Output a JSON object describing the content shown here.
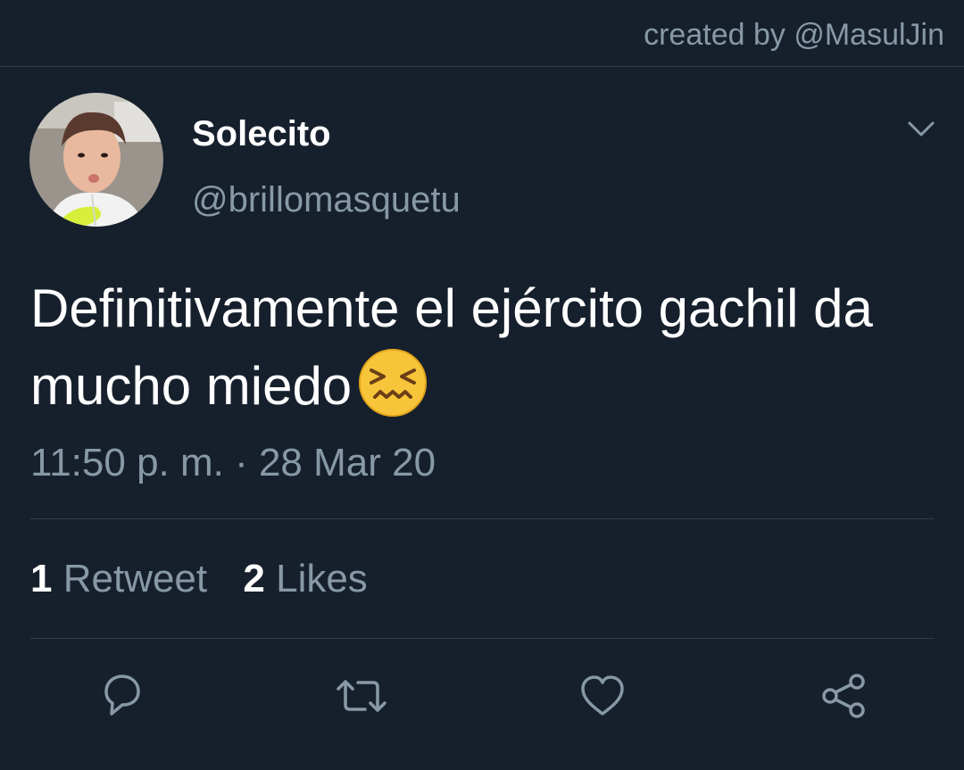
{
  "header": {
    "credit": "created by @MasulJin"
  },
  "tweet": {
    "display_name": "Solecito",
    "handle": "@brillomasquetu",
    "text": "Definitivamente el ejército gachil da mucho miedo",
    "emoji": "confounded-face",
    "timestamp": "11:50 p. m. · 28 Mar 20"
  },
  "stats": {
    "retweets_count": "1",
    "retweets_label": "Retweet",
    "likes_count": "2",
    "likes_label": "Likes"
  },
  "actions": {
    "reply_icon": "reply-icon",
    "retweet_icon": "retweet-icon",
    "like_icon": "heart-icon",
    "share_icon": "share-icon"
  },
  "colors": {
    "background": "#16202c",
    "secondary_text": "#8899a6",
    "divider": "#2f3a46",
    "emoji_yellow": "#f7c53a"
  }
}
